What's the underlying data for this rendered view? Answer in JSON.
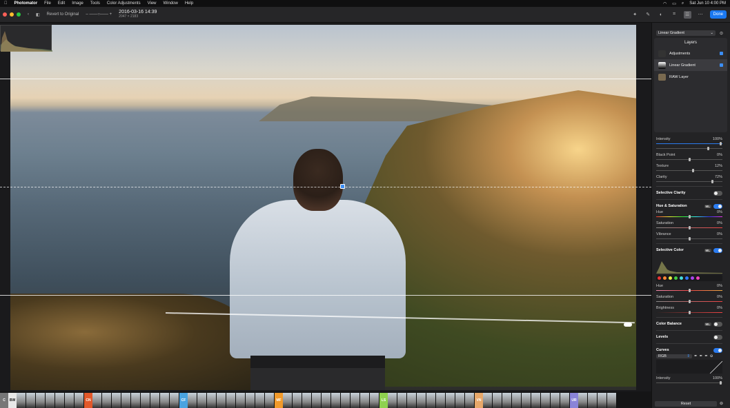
{
  "menubar": {
    "app": "Photomator",
    "items": [
      "File",
      "Edit",
      "Image",
      "Tools",
      "Color Adjustments",
      "View",
      "Window",
      "Help"
    ],
    "clock": "Sat Jun 10  4:00 PM"
  },
  "toolbar": {
    "revert_label": "Revert to Original",
    "doc_title": "2016-03-16 14:39",
    "doc_size": "2047 × 2183",
    "done_label": "Done"
  },
  "sidebar": {
    "preset": "Linear Gradient",
    "layers_title": "Layers",
    "layers": [
      {
        "name": "Adjustments"
      },
      {
        "name": "Linear Gradient"
      },
      {
        "name": "RAW Layer"
      }
    ],
    "intensity": {
      "label": "Intensity",
      "value": "100%"
    },
    "black_point": {
      "label": "Black Point",
      "value": "0%"
    },
    "texture": {
      "label": "Texture",
      "value": "12%"
    },
    "clarity": {
      "label": "Clarity",
      "value": "72%"
    },
    "selective_clarity": "Selective Clarity",
    "hue_sat": {
      "title": "Hue & Saturation",
      "ml": "ML",
      "hue": {
        "label": "Hue",
        "value": "0%"
      },
      "saturation": {
        "label": "Saturation",
        "value": "0%"
      },
      "vibrance": {
        "label": "Vibrance",
        "value": "0%"
      }
    },
    "selective_color": {
      "title": "Selective Color",
      "ml": "ML",
      "hue": {
        "label": "Hue",
        "value": "0%"
      },
      "saturation": {
        "label": "Saturation",
        "value": "0%"
      },
      "brightness": {
        "label": "Brightness",
        "value": "0%"
      }
    },
    "color_balance": {
      "title": "Color Balance",
      "ml": "ML"
    },
    "levels": "Levels",
    "curves": {
      "title": "Curves",
      "channel": "RGB"
    },
    "bottom_intensity": {
      "label": "Intensity",
      "value": "100%"
    },
    "reset_label": "Reset"
  },
  "filmstrip": {
    "categories": [
      {
        "code": "C",
        "color": "#777"
      },
      {
        "code": "BW",
        "color": "#e8e8e8"
      },
      {
        "code": "CN",
        "color": "#e2582a"
      },
      {
        "code": "CF",
        "color": "#4aa3e0"
      },
      {
        "code": "MF",
        "color": "#f29a2a"
      },
      {
        "code": "LS",
        "color": "#8fd14f"
      },
      {
        "code": "VN",
        "color": "#e8a86a"
      },
      {
        "code": "UR",
        "color": "#8a84d8"
      }
    ]
  },
  "colors": {
    "accent": "#2b7cf0",
    "done": "#1a78f0"
  }
}
